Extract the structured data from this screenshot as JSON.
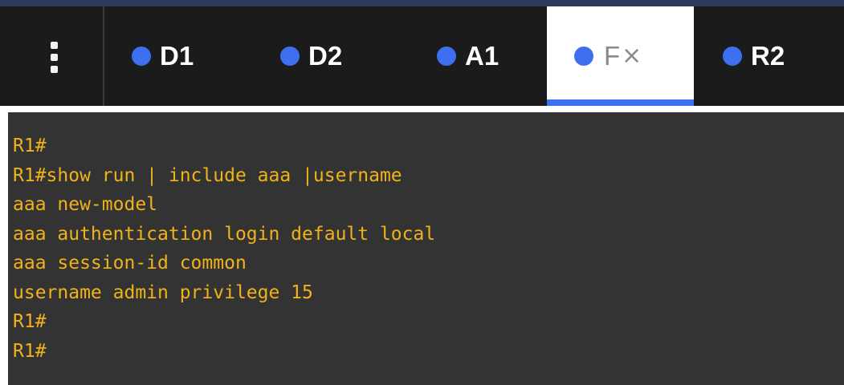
{
  "colors": {
    "tab_dot": "#3d6ff0",
    "terminal_bg": "#333333",
    "terminal_text": "#f0b21a",
    "tabbar_bg": "#1b1b1b"
  },
  "tabs": [
    {
      "label": "D1",
      "active": false
    },
    {
      "label": "D2",
      "active": false
    },
    {
      "label": "A1",
      "active": false
    },
    {
      "label": "F",
      "active": true,
      "close_icon": "×"
    },
    {
      "label": "R2",
      "active": false
    }
  ],
  "terminal": {
    "lines": [
      "R1#",
      "R1#show run | include aaa |username",
      "aaa new-model",
      "aaa authentication login default local",
      "aaa session-id common",
      "username admin privilege 15",
      "R1#",
      "R1#"
    ]
  }
}
